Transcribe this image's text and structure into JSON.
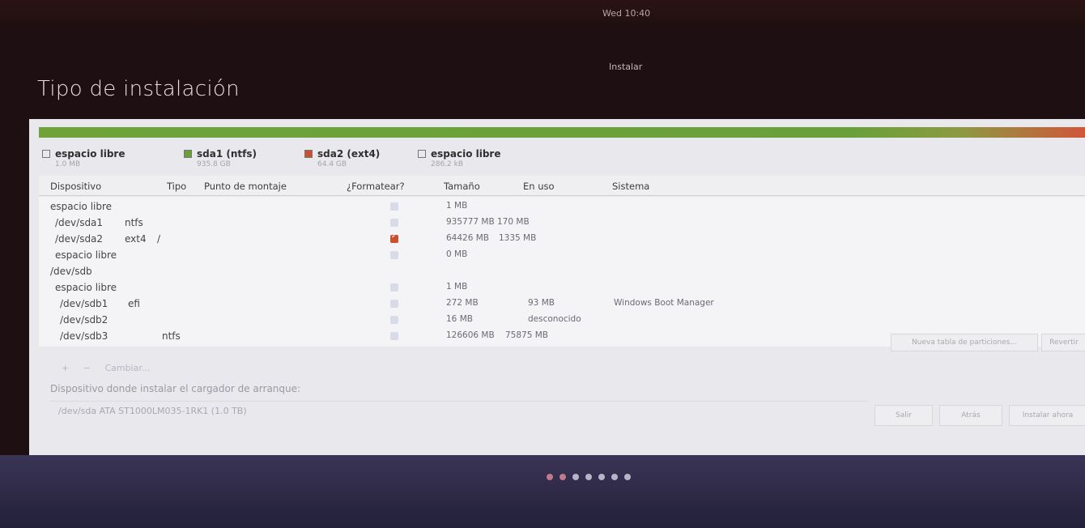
{
  "topbar": {
    "clock": "Wed 10:40"
  },
  "window": {
    "title": "Instalar"
  },
  "page": {
    "title": "Tipo de instalación"
  },
  "partition_legend": [
    {
      "name": "espacio libre",
      "size": "1.0 MB",
      "color": "#ffffff"
    },
    {
      "name": "sda1 (ntfs)",
      "size": "935.8 GB",
      "color": "#6a9f3a"
    },
    {
      "name": "sda2 (ext4)",
      "size": "64.4 GB",
      "color": "#c8512f"
    },
    {
      "name": "espacio libre",
      "size": "286.2 kB",
      "color": "#ffffff"
    }
  ],
  "table": {
    "headers": [
      "Dispositivo",
      "Tipo",
      "Punto de montaje",
      "¿Formatear?",
      "Tamaño",
      "En uso",
      "Sistema"
    ],
    "rows": [
      {
        "device": "espacio libre",
        "type": "",
        "mount": "",
        "format": false,
        "size": "1 MB",
        "used": "",
        "system": ""
      },
      {
        "device": "/dev/sda1",
        "type": "ntfs",
        "mount": "",
        "format": false,
        "size": "935777 MB",
        "used": "170 MB",
        "system": ""
      },
      {
        "device": "/dev/sda2",
        "type": "ext4",
        "mount": "/",
        "format": true,
        "size": "64426 MB",
        "used": "1335 MB",
        "system": ""
      },
      {
        "device": "espacio libre",
        "type": "",
        "mount": "",
        "format": false,
        "size": "0 MB",
        "used": "",
        "system": ""
      },
      {
        "device": "/dev/sdb",
        "type": "",
        "mount": "",
        "format": null,
        "size": "",
        "used": "",
        "system": ""
      },
      {
        "device": "espacio libre",
        "type": "",
        "mount": "",
        "format": false,
        "size": "1 MB",
        "used": "",
        "system": ""
      },
      {
        "device": "/dev/sdb1",
        "type": "efi",
        "mount": "",
        "format": false,
        "size": "272 MB",
        "used": "93 MB",
        "system": "Windows Boot Manager"
      },
      {
        "device": "/dev/sdb2",
        "type": "",
        "mount": "",
        "format": false,
        "size": "16 MB",
        "used": "desconocido",
        "system": ""
      },
      {
        "device": "/dev/sdb3",
        "type": "ntfs",
        "mount": "",
        "format": false,
        "size": "126606 MB",
        "used": "75875 MB",
        "system": ""
      }
    ]
  },
  "actions": {
    "add": "+",
    "remove": "−",
    "change": "Cambiar..."
  },
  "buttons": {
    "new_table": "Nueva tabla de particiones...",
    "revert": "Revertir",
    "quit": "Salir",
    "back": "Atrás",
    "install_now": "Instalar ahora"
  },
  "bootloader": {
    "label": "Dispositivo donde instalar el cargador de arranque:",
    "value": "/dev/sda   ATA ST1000LM035-1RK1 (1.0 TB)"
  },
  "progress": {
    "total_steps": 7,
    "current_step": 2
  }
}
